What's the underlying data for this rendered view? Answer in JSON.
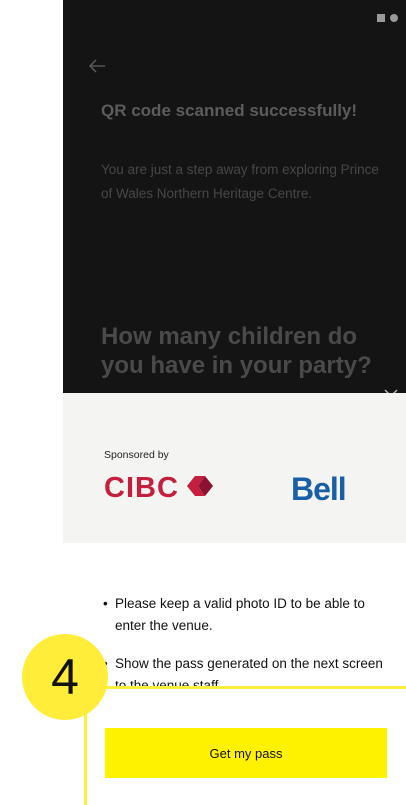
{
  "header": {
    "title": "QR code scanned successfully!",
    "subtitle": "You are just a step away from exploring Prince of Wales Northern Heritage Centre.",
    "question": "How many children do you have in your party?"
  },
  "sponsor": {
    "label": "Sponsored by",
    "cibc": "CIBC",
    "bell": "Bell",
    "cibc_color": "#c41f3e",
    "bell_color": "#1a5fa6"
  },
  "instructions": [
    "Please keep a valid photo ID to be able to enter the venue.",
    "Show the pass generated on the next screen to the venue staff."
  ],
  "actions": {
    "pass_button": "Get my pass",
    "button_color": "#fff200"
  },
  "annotation": {
    "step": "4",
    "highlight_color": "#ffed3a"
  },
  "icons": [
    "back-arrow-icon",
    "close-icon",
    "signal-icon",
    "battery-icon",
    "cibc-logo-icon"
  ]
}
